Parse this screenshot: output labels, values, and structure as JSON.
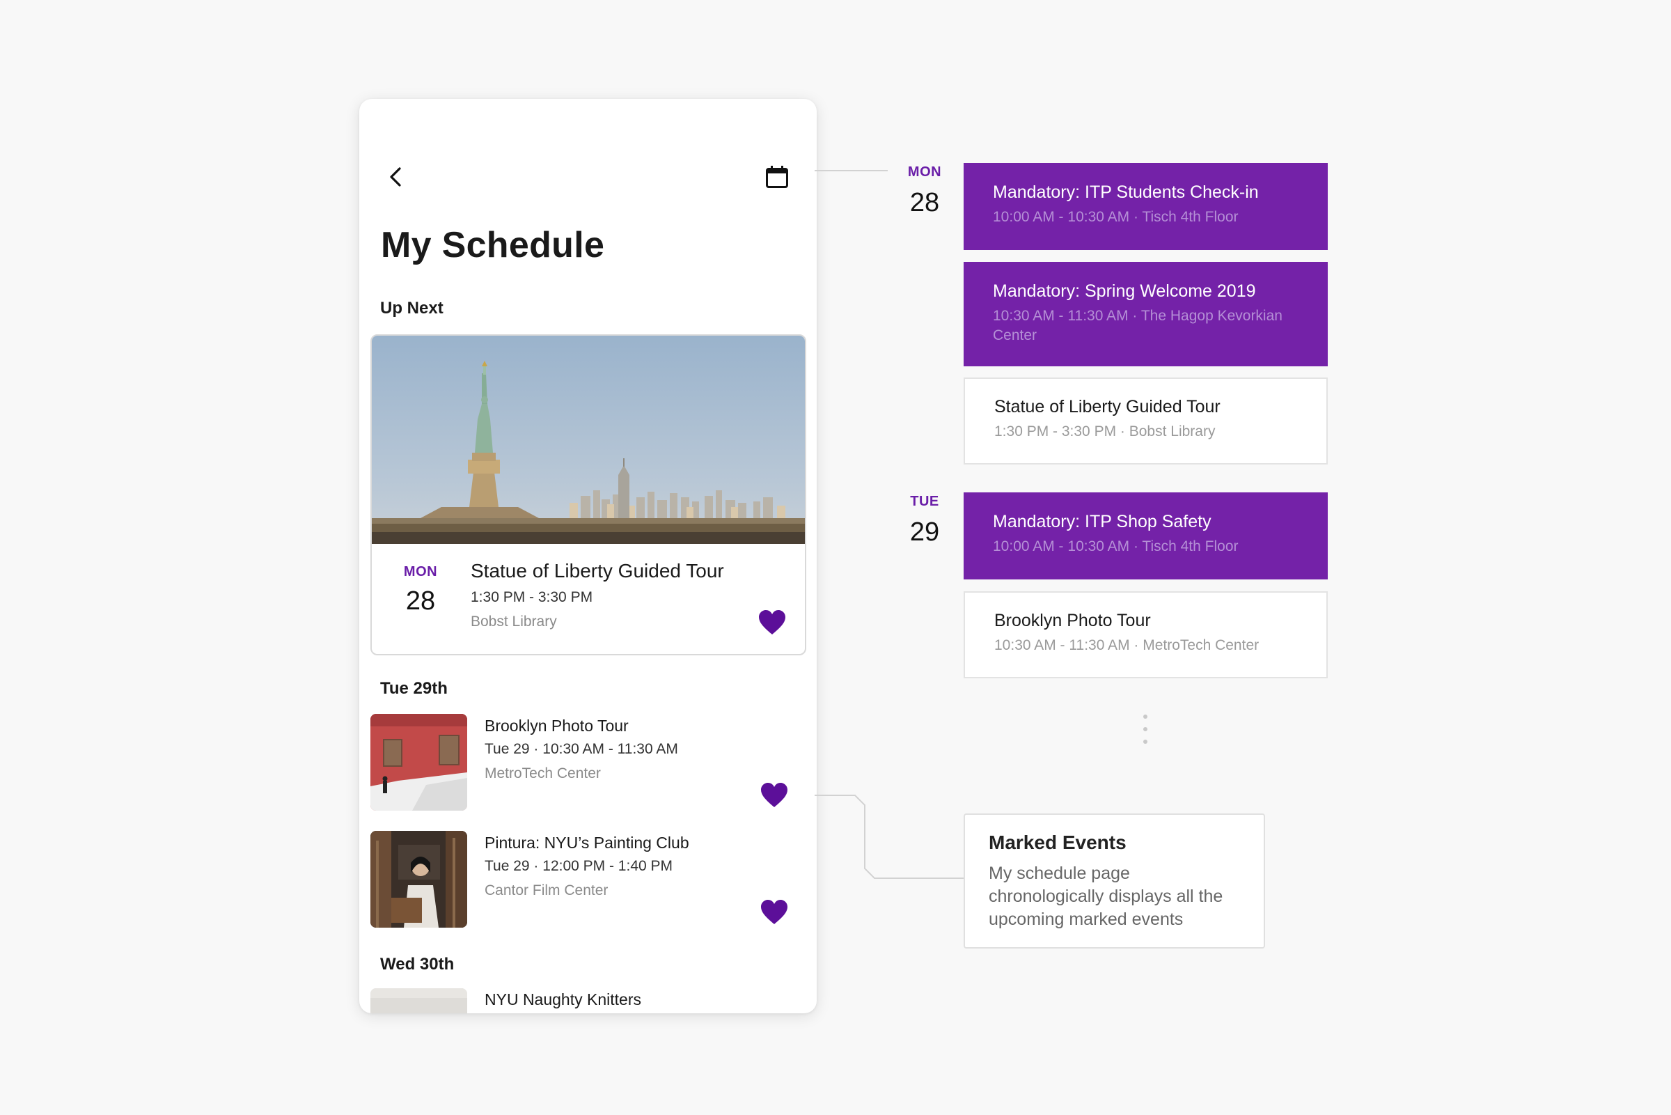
{
  "colors": {
    "accent_purple": "#6a1ea8",
    "card_purple": "#7422a8",
    "heart_purple": "#5c0f99",
    "background": "#f8f8f8"
  },
  "phone": {
    "header": {
      "back_icon": "chevron-left-icon",
      "calendar_icon": "calendar-icon"
    },
    "title": "My Schedule",
    "up_next": {
      "label": "Up Next",
      "image": "statue-of-liberty-photo",
      "date": {
        "dow": "MON",
        "day": "28"
      },
      "title": "Statue of Liberty Guided Tour",
      "time": "1:30 PM - 3:30 PM",
      "location": "Bobst Library",
      "favorite_icon": "heart-icon",
      "favorited": true
    },
    "sections": [
      {
        "label": "Tue 29th",
        "events": [
          {
            "title": "Brooklyn Photo Tour",
            "time": "Tue 29 · 10:30 AM - 11:30 AM",
            "location": "MetroTech Center",
            "thumbnail": "red-wall-photo",
            "favorited": true
          },
          {
            "title": "Pintura: NYU’s Painting Club",
            "time": "Tue 29 · 12:00 PM - 1:40 PM",
            "location": "Cantor Film Center",
            "thumbnail": "painter-photo",
            "favorited": true
          }
        ]
      },
      {
        "label": "Wed 30th",
        "events": [
          {
            "title": "NYU Naughty Knitters",
            "thumbnail": "knitting-photo"
          }
        ]
      }
    ]
  },
  "timeline": {
    "days": [
      {
        "dow": "MON",
        "day": "28",
        "events": [
          {
            "title": "Mandatory: ITP Students Check-in",
            "subtitle": "10:00 AM - 10:30 AM · Tisch 4th Floor",
            "style": "purple"
          },
          {
            "title": "Mandatory: Spring Welcome 2019",
            "subtitle": "10:30 AM - 11:30 AM · The Hagop Kevorkian Center",
            "style": "purple"
          },
          {
            "title": "Statue of Liberty Guided Tour",
            "subtitle": "1:30 PM - 3:30 PM · Bobst Library",
            "style": "white"
          }
        ]
      },
      {
        "dow": "TUE",
        "day": "29",
        "events": [
          {
            "title": "Mandatory: ITP Shop Safety",
            "subtitle": "10:00 AM - 10:30 AM · Tisch 4th Floor",
            "style": "purple"
          },
          {
            "title": "Brooklyn Photo Tour",
            "subtitle": "10:30 AM - 11:30 AM · MetroTech Center",
            "style": "white"
          }
        ]
      }
    ]
  },
  "annotation": {
    "title": "Marked Events",
    "body": "My schedule page chronologically displays all the upcoming marked events"
  }
}
